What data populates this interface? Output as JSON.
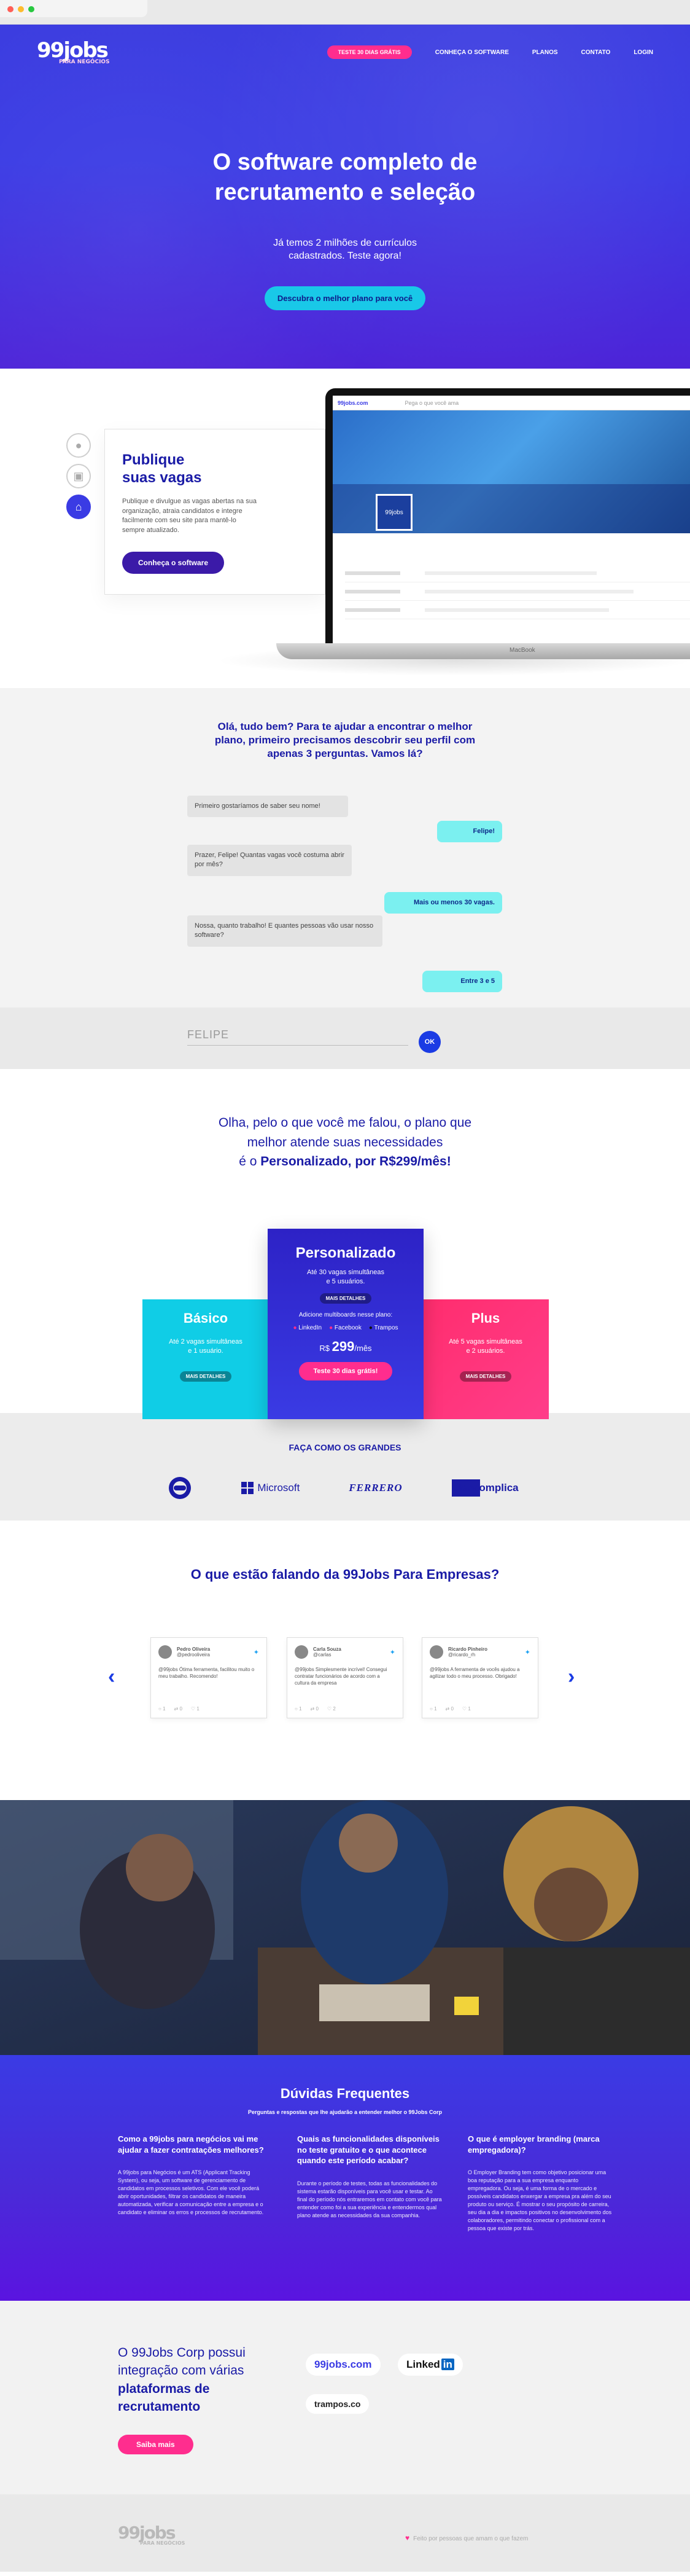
{
  "nav": {
    "logo": "99jobs",
    "logo_sub": "PARA NEGÓCIOS",
    "cta": "TESTE 30 DIAS GRÁTIS",
    "links": [
      "CONHEÇA O SOFTWARE",
      "PLANOS",
      "CONTATO",
      "LOGIN"
    ]
  },
  "hero": {
    "title_line1": "O software completo de",
    "title_line2": "recrutamento e seleção",
    "sub_line1": "Já temos 2 milhões de currículos",
    "sub_line2": "cadastrados. Teste agora!",
    "cta": "Descubra o melhor plano para você"
  },
  "feature": {
    "title_line1": "Publique",
    "title_line2": "suas vagas",
    "desc": "Publique e divulgue as vagas abertas na sua organização, atraia candidatos e integre facilmente com seu site para mantê-lo sempre atualizado.",
    "cta": "Conheça o software",
    "laptop_brand": "MacBook",
    "screen_logo": "99jobs.com",
    "screen_tagline": "Pega o que você ama",
    "screen_company": "99jobs"
  },
  "chat": {
    "title_line1": "Olá, tudo bem? Para te ajudar a encontrar o melhor",
    "title_line2": "plano, primeiro precisamos descobrir seu perfil com",
    "title_line3": "apenas 3 perguntas. Vamos lá?",
    "messages": [
      {
        "from": "bot",
        "text": "Primeiro gostaríamos de saber seu nome!"
      },
      {
        "from": "me",
        "text": "Felipe!"
      },
      {
        "from": "bot",
        "text": "Prazer, Felipe! Quantas vagas você costuma abrir por mês?"
      },
      {
        "from": "me",
        "text": "Mais ou menos 30 vagas."
      },
      {
        "from": "bot",
        "text": "Nossa, quanto trabalho! E quantes pessoas vão usar nosso software?"
      },
      {
        "from": "me",
        "text": "Entre 3 e 5"
      }
    ],
    "input_placeholder": "FELIPE",
    "ok": "OK"
  },
  "recommendation": {
    "line1": "Olha, pelo o que você me falou, o plano que",
    "line2": "melhor atende suas necessidades",
    "line3_prefix": "é o ",
    "line3_bold": "Personalizado, por R$299/mês!"
  },
  "plans": {
    "basic": {
      "name": "Básico",
      "line1": "Até 2 vagas simultâneas",
      "line2": "e 1 usuário.",
      "btn": "MAIS DETALHES"
    },
    "main": {
      "name": "Personalizado",
      "line1": "Até 30 vagas simultâneas",
      "line2": "e 5 usuários.",
      "btn": "MAIS DETALHES",
      "extra": "Adicione multiboards nesse plano:",
      "boards": [
        "LinkedIn",
        "Facebook",
        "Trampos"
      ],
      "price_prefix": "R$",
      "price": "299",
      "price_suffix": "/mês",
      "cta": "Teste 30 dias grátis!"
    },
    "plus": {
      "name": "Plus",
      "line1": "Até 5 vagas simultâneas",
      "line2": "e 2 usuários.",
      "btn": "MAIS DETALHES"
    }
  },
  "brands": {
    "title": "FAÇA COMO OS GRANDES",
    "items": [
      "Microsoft",
      "FERRERO",
      "descomplica"
    ]
  },
  "testimonials": {
    "title": "O que estão falando da 99Jobs Para Empresas?",
    "cards": [
      {
        "name": "Pedro Oliveira",
        "handle": "@pedrooliveira",
        "text": "@99jobs Ótima ferramenta, facilitou muito o meu trabalho. Recomendo!",
        "likes": "1",
        "rts": "0",
        "replies": "1"
      },
      {
        "name": "Carla Souza",
        "handle": "@carlas",
        "text": "@99jobs Simplesmente incrível! Consegui contratar funcionários de acordo com a cultura da empresa",
        "likes": "1",
        "rts": "0",
        "replies": "2"
      },
      {
        "name": "Ricardo Pinheiro",
        "handle": "@ricardo_rh",
        "text": "@99jobs A ferramenta de vocês ajudou a agilizar todo o meu processo. Obrigado!",
        "likes": "1",
        "rts": "0",
        "replies": "1"
      }
    ]
  },
  "faq": {
    "title": "Dúvidas Frequentes",
    "subtitle": "Perguntas e respostas que lhe ajudarão a entender melhor o 99Jobs Corp",
    "items": [
      {
        "q": "Como a 99jobs para negócios vai me ajudar a fazer contratações melhores?",
        "a": "A 99jobs para Negócios é um ATS (Applicant Tracking System), ou seja, um software de gerenciamento de candidatos em processos seletivos. Com ele você poderá abrir oportunidades, filtrar os candidatos de maneira automatizada, verificar a comunicação entre a empresa e o candidato e eliminar os erros e processos de recrutamento."
      },
      {
        "q": "Quais as funcionalidades disponíveis no teste gratuito e o que acontece quando este período acabar?",
        "a": "Durante o período de testes, todas as funcionalidades do sistema estarão disponíveis para você usar e testar. Ao final do período nós entraremos em contato com você para entender como foi a sua experiência e entendermos qual plano atende as necessidades da sua companhia."
      },
      {
        "q": "O que é employer branding (marca empregadora)?",
        "a": "O Employer Branding tem como objetivo posicionar uma boa reputação para a sua empresa enquanto empregadora. Ou seja, é uma forma de o mercado e possíveis candidatos enxergar a empresa pra além do seu produto ou serviço. É mostrar o seu propósito de carreira, seu dia a dia e impactos positivos no desenvolvimento dos colaboradores, permitindo conectar o profissional com a pessoa que existe por trás."
      }
    ]
  },
  "integration": {
    "line1": "O 99Jobs Corp possui",
    "line2": "integração com várias",
    "line3": "plataformas de",
    "line4": "recrutamento",
    "cta": "Saiba mais",
    "partners": [
      "99jobs.com",
      "Linked",
      "in",
      "trampos.co"
    ]
  },
  "footer": {
    "logo": "99jobs",
    "logo_sub": "PARA NEGÓCIOS",
    "made_by": "Feito por pessoas que amam o que fazem"
  },
  "colors": {
    "primary": "#3a3be4",
    "pink": "#ff2d8e",
    "cyan": "#10cde6",
    "navy": "#1a1ba6"
  }
}
